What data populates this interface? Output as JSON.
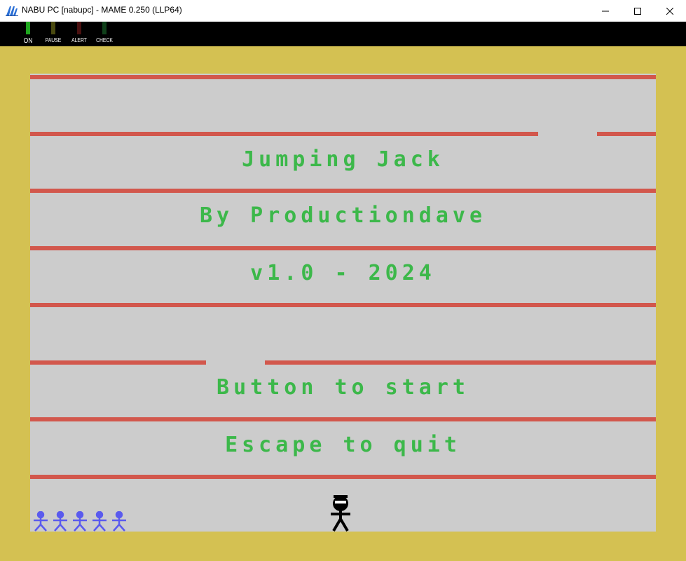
{
  "window": {
    "title": "NABU PC [nabupc] - MAME 0.250 (LLP64)",
    "icon": "mame-logo-icon",
    "controls": [
      "minimize-icon",
      "maximize-icon",
      "close-icon"
    ]
  },
  "leds": [
    {
      "label": "ON",
      "color": "#1fa61f",
      "lit": true
    },
    {
      "label": "PAUSE",
      "color": "#4a4a10",
      "lit": false
    },
    {
      "label": "ALERT",
      "color": "#4a1010",
      "lit": false
    },
    {
      "label": "CHECK",
      "color": "#10401a",
      "lit": false
    }
  ],
  "game": {
    "title": "Jumping Jack",
    "author": "By Productiondave",
    "version": "v1.0 - 2024",
    "start_prompt": "Button to start",
    "quit_prompt": "Escape to quit",
    "lives": 5,
    "colors": {
      "border": "#d4c152",
      "playfield": "#cccccc",
      "floor": "#d2574c",
      "text": "#3cb84a",
      "life_icon": "#5a5aee",
      "player": "#000000"
    }
  }
}
